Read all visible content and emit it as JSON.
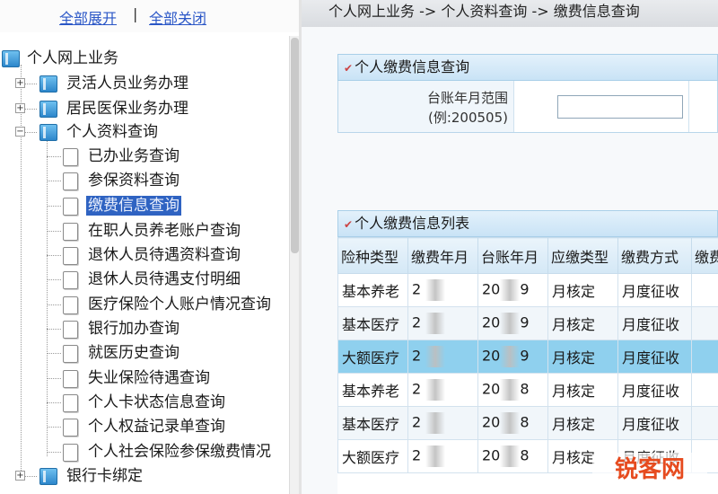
{
  "tree_panel": {
    "expand_all": "全部展开",
    "separator": "|",
    "collapse_all": "全部关闭",
    "root": "个人网上业务",
    "groups": [
      {
        "label": "灵活人员业务办理",
        "expander": "+"
      },
      {
        "label": "居民医保业务办理",
        "expander": "+"
      },
      {
        "label": "个人资料查询",
        "expander": "−"
      }
    ],
    "children": [
      "已办业务查询",
      "参保资料查询",
      "缴费信息查询",
      "在职人员养老账户查询",
      "退休人员待遇资料查询",
      "退休人员待遇支付明细",
      "医疗保险个人账户情况查询",
      "银行加办查询",
      "就医历史查询",
      "失业保险待遇查询",
      "个人卡状态信息查询",
      "个人权益记录单查询",
      "个人社会保险参保缴费情况"
    ],
    "selected_child_index": 2,
    "bottom_group": {
      "label": "银行卡绑定",
      "expander": "+"
    }
  },
  "content": {
    "breadcrumb": "个人网上业务 -> 个人资料查询 -> 缴费信息查询",
    "query_section": {
      "mark": "✔",
      "title": "个人缴费信息查询",
      "field_label_line1": "台账年月范围",
      "field_label_line2": "(例:200505)",
      "field_value": ""
    },
    "list_section": {
      "mark": "✔",
      "title": "个人缴费信息列表",
      "columns": [
        "险种类型",
        "缴费年月",
        "台账年月",
        "应缴类型",
        "缴费方式",
        "缴费"
      ],
      "rows": [
        [
          "基本养老",
          "2",
          "20",
          "9",
          "月核定",
          "月度征收"
        ],
        [
          "基本医疗",
          "2",
          "20",
          "9",
          "月核定",
          "月度征收"
        ],
        [
          "大额医疗",
          "2",
          "20",
          "9",
          "月核定",
          "月度征收"
        ],
        [
          "基本养老",
          "2",
          "20",
          "8",
          "月核定",
          "月度征收"
        ],
        [
          "基本医疗",
          "2",
          "20",
          "8",
          "月核定",
          "月度征收"
        ],
        [
          "大额医疗",
          "2",
          "20",
          "8",
          "月核定",
          "月度征收"
        ]
      ],
      "selected_row_index": 2
    }
  },
  "watermark": "锐客网",
  "colors": {
    "link": "#2b57c7",
    "selection": "#2f63c2",
    "row_highlight": "#8fd0ee",
    "header_blue": "#c9e3f6",
    "watermark": "#e64b1f"
  }
}
